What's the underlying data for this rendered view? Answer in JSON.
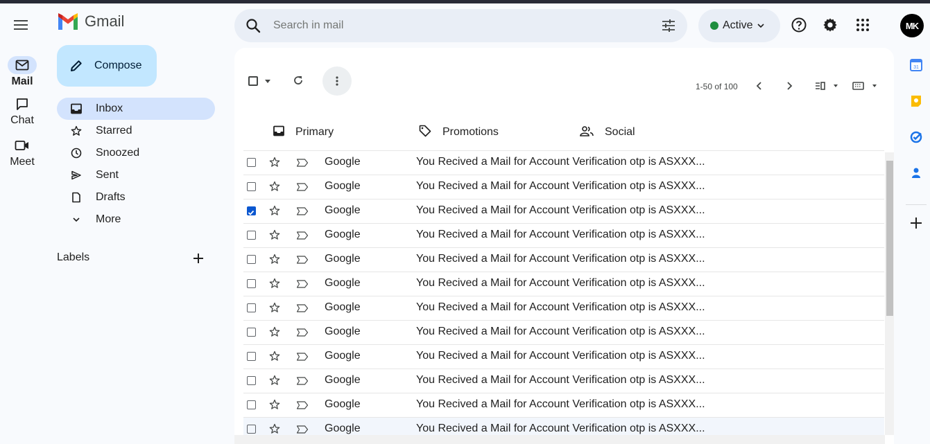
{
  "app": {
    "brand": "Gmail"
  },
  "rail": {
    "items": [
      {
        "label": "Mail",
        "icon": "mail-icon",
        "active": true
      },
      {
        "label": "Chat",
        "icon": "chat-icon",
        "active": false
      },
      {
        "label": "Meet",
        "icon": "video-icon",
        "active": false
      }
    ]
  },
  "search": {
    "placeholder": "Search in mail"
  },
  "status": {
    "label": "Active",
    "color": "#1e8e3e"
  },
  "account": {
    "initials": "MK"
  },
  "compose": {
    "label": "Compose"
  },
  "nav": {
    "items": [
      {
        "label": "Inbox",
        "icon": "inbox-icon",
        "active": true
      },
      {
        "label": "Starred",
        "icon": "star-icon"
      },
      {
        "label": "Snoozed",
        "icon": "clock-icon"
      },
      {
        "label": "Sent",
        "icon": "send-icon"
      },
      {
        "label": "Drafts",
        "icon": "draft-icon"
      },
      {
        "label": "More",
        "icon": "chevron-down-icon"
      }
    ],
    "labels_title": "Labels"
  },
  "toolbar": {
    "pagination": "1-50 of 100"
  },
  "tabs": [
    {
      "label": "Primary",
      "icon": "inbox-icon"
    },
    {
      "label": "Promotions",
      "icon": "tag-icon"
    },
    {
      "label": "Social",
      "icon": "people-icon"
    }
  ],
  "emails": [
    {
      "sender": "Google",
      "subject": "You Recived a Mail for Account Verification otp is ASXXX...",
      "checked": false
    },
    {
      "sender": "Google",
      "subject": "You Recived a Mail for Account Verification otp is ASXXX...",
      "checked": false
    },
    {
      "sender": "Google",
      "subject": "You Recived a Mail for Account Verification otp is ASXXX...",
      "checked": true
    },
    {
      "sender": "Google",
      "subject": "You Recived a Mail for Account Verification otp is ASXXX...",
      "checked": false
    },
    {
      "sender": "Google",
      "subject": "You Recived a Mail for Account Verification otp is ASXXX...",
      "checked": false
    },
    {
      "sender": "Google",
      "subject": "You Recived a Mail for Account Verification otp is ASXXX...",
      "checked": false
    },
    {
      "sender": "Google",
      "subject": "You Recived a Mail for Account Verification otp is ASXXX...",
      "checked": false
    },
    {
      "sender": "Google",
      "subject": "You Recived a Mail for Account Verification otp is ASXXX...",
      "checked": false
    },
    {
      "sender": "Google",
      "subject": "You Recived a Mail for Account Verification otp is ASXXX...",
      "checked": false
    },
    {
      "sender": "Google",
      "subject": "You Recived a Mail for Account Verification otp is ASXXX...",
      "checked": false
    },
    {
      "sender": "Google",
      "subject": "You Recived a Mail for Account Verification otp is ASXXX...",
      "checked": false
    },
    {
      "sender": "Google",
      "subject": "You Recived a Mail for Account Verification otp is ASXXX...",
      "checked": false
    }
  ],
  "side_panel": {
    "apps": [
      {
        "icon": "calendar-icon",
        "text": "31",
        "color": "#4285f4"
      },
      {
        "icon": "keep-icon",
        "color": "#fbbc04"
      },
      {
        "icon": "tasks-icon",
        "color": "#1a73e8"
      },
      {
        "icon": "contacts-icon",
        "color": "#1a73e8"
      },
      {
        "icon": "plus-icon",
        "color": "#444746"
      }
    ]
  }
}
